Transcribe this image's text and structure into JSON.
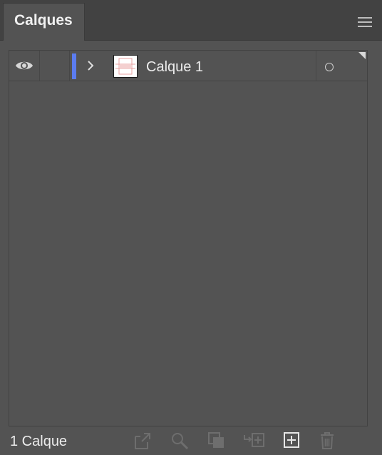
{
  "panel": {
    "tab_label": "Calques",
    "menu_icon": "hamburger-menu-icon"
  },
  "layers": [
    {
      "name": "Calque 1",
      "visible": true,
      "locked": false,
      "expanded": false,
      "color": "#5b7cf0"
    }
  ],
  "footer": {
    "count_label": "1 Calque",
    "buttons": [
      {
        "icon": "export-icon",
        "enabled": false
      },
      {
        "icon": "locate-object-icon",
        "enabled": false
      },
      {
        "icon": "make-clipping-mask-icon",
        "enabled": false
      },
      {
        "icon": "create-sublayer-icon",
        "enabled": false
      },
      {
        "icon": "create-new-layer-icon",
        "enabled": true
      },
      {
        "icon": "delete-layer-icon",
        "enabled": false
      }
    ]
  },
  "colors": {
    "panel_bg": "#535353",
    "header_bg": "#424242",
    "layer_color": "#5b7cf0",
    "text": "#ececec"
  }
}
